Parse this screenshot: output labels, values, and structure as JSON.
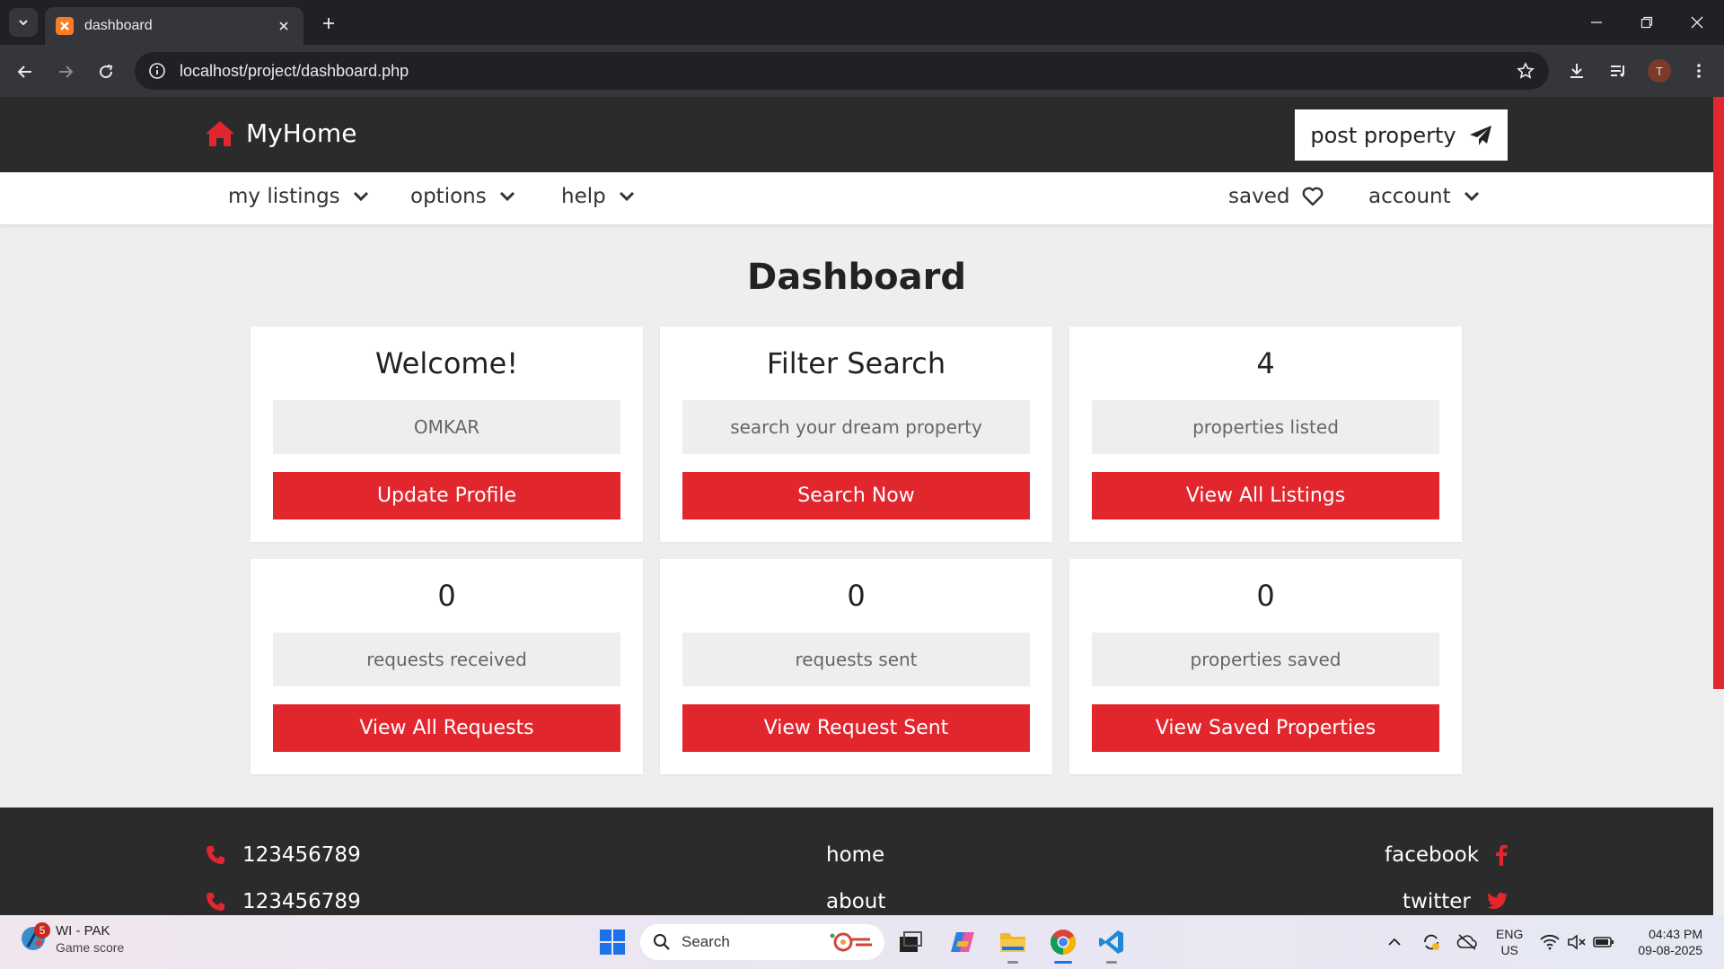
{
  "browser": {
    "tab_title": "dashboard",
    "url": "localhost/project/dashboard.php",
    "profile_initial": "T"
  },
  "site": {
    "logo_text": "MyHome",
    "post_property_label": "post property",
    "nav": {
      "my_listings": "my listings",
      "options": "options",
      "help": "help",
      "saved": "saved",
      "account": "account"
    },
    "page_title": "Dashboard",
    "cards": [
      {
        "heading": "Welcome!",
        "info": "OMKAR",
        "button": "Update Profile"
      },
      {
        "heading": "Filter Search",
        "info": "search your dream property",
        "button": "Search Now"
      },
      {
        "heading": "4",
        "info": "properties listed",
        "button": "View All Listings"
      },
      {
        "heading": "0",
        "info": "requests received",
        "button": "View All Requests"
      },
      {
        "heading": "0",
        "info": "requests sent",
        "button": "View Request Sent"
      },
      {
        "heading": "0",
        "info": "properties saved",
        "button": "View Saved Properties"
      }
    ],
    "footer": {
      "phone_1": "123456789",
      "phone_2": "123456789",
      "link_home": "home",
      "link_about": "about",
      "social_facebook": "facebook",
      "social_twitter": "twitter"
    },
    "colors": {
      "accent": "#e2262e",
      "header_bg": "#2b2b2b",
      "page_bg": "#eeeeee"
    }
  },
  "taskbar": {
    "weather_title": "WI - PAK",
    "weather_sub": "Game score",
    "weather_badge": "5",
    "search_label": "Search",
    "lang_1": "ENG",
    "lang_2": "US",
    "time": "04:43 PM",
    "date": "09-08-2025"
  }
}
